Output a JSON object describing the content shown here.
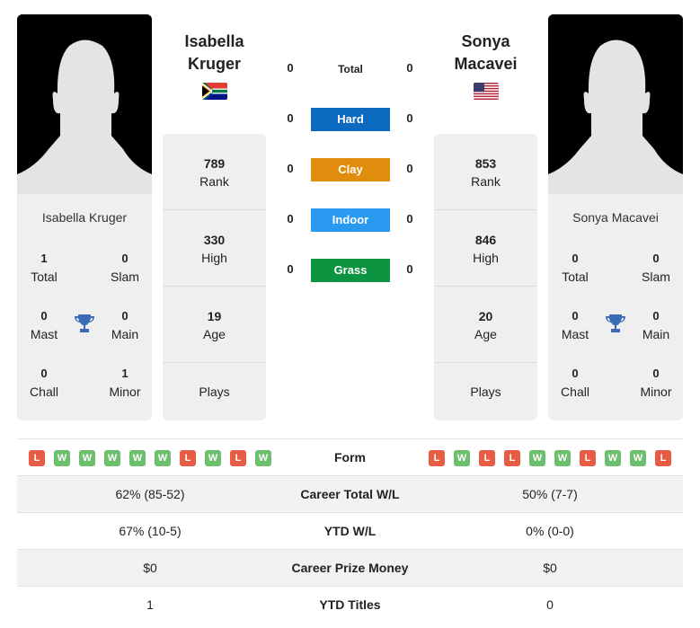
{
  "left_player": {
    "name": "Isabella Kruger",
    "name_line1": "Isabella",
    "name_line2": "Kruger",
    "flag": "south-africa-flag",
    "titles": {
      "total": {
        "value": "1",
        "label": "Total"
      },
      "slam": {
        "value": "0",
        "label": "Slam"
      },
      "mast": {
        "value": "0",
        "label": "Mast"
      },
      "main": {
        "value": "0",
        "label": "Main"
      },
      "chall": {
        "value": "0",
        "label": "Chall"
      },
      "minor": {
        "value": "1",
        "label": "Minor"
      }
    },
    "rank": {
      "value": "789",
      "label": "Rank"
    },
    "high": {
      "value": "330",
      "label": "High"
    },
    "age": {
      "value": "19",
      "label": "Age"
    },
    "plays": {
      "value": "",
      "label": "Plays"
    }
  },
  "right_player": {
    "name": "Sonya Macavei",
    "name_line1": "Sonya",
    "name_line2": "Macavei",
    "flag": "usa-flag",
    "titles": {
      "total": {
        "value": "0",
        "label": "Total"
      },
      "slam": {
        "value": "0",
        "label": "Slam"
      },
      "mast": {
        "value": "0",
        "label": "Mast"
      },
      "main": {
        "value": "0",
        "label": "Main"
      },
      "chall": {
        "value": "0",
        "label": "Chall"
      },
      "minor": {
        "value": "0",
        "label": "Minor"
      }
    },
    "rank": {
      "value": "853",
      "label": "Rank"
    },
    "high": {
      "value": "846",
      "label": "High"
    },
    "age": {
      "value": "20",
      "label": "Age"
    },
    "plays": {
      "value": "",
      "label": "Plays"
    }
  },
  "h2h": [
    {
      "label": "Total",
      "left": "0",
      "right": "0",
      "color": ""
    },
    {
      "label": "Hard",
      "left": "0",
      "right": "0",
      "color": "#0c6bbf"
    },
    {
      "label": "Clay",
      "left": "0",
      "right": "0",
      "color": "#e08c0c"
    },
    {
      "label": "Indoor",
      "left": "0",
      "right": "0",
      "color": "#2a9af0"
    },
    {
      "label": "Grass",
      "left": "0",
      "right": "0",
      "color": "#0d9440"
    }
  ],
  "form": {
    "label": "Form",
    "left": [
      "L",
      "W",
      "W",
      "W",
      "W",
      "W",
      "L",
      "W",
      "L",
      "W"
    ],
    "right": [
      "L",
      "W",
      "L",
      "L",
      "W",
      "W",
      "L",
      "W",
      "W",
      "L"
    ]
  },
  "stats_rows": [
    {
      "label": "Career Total W/L",
      "left": "62% (85-52)",
      "right": "50% (7-7)"
    },
    {
      "label": "YTD W/L",
      "left": "67% (10-5)",
      "right": "0% (0-0)"
    },
    {
      "label": "Career Prize Money",
      "left": "$0",
      "right": "$0"
    },
    {
      "label": "YTD Titles",
      "left": "1",
      "right": "0"
    }
  ],
  "colors": {
    "win": "#6cbf6c",
    "loss": "#e85c46",
    "trophy": "#3a6cb5"
  }
}
